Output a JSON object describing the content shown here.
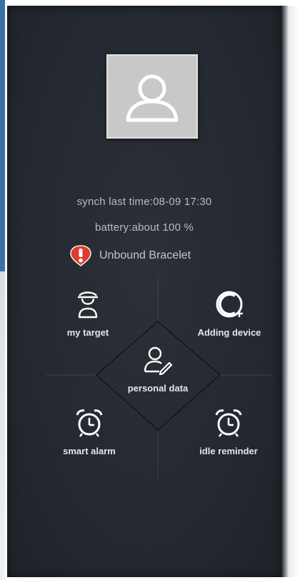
{
  "profile": {
    "avatar_icon": "user-avatar-icon"
  },
  "status": {
    "sync_text": "synch last time:08-09 17:30",
    "battery_text": "battery:about 100 %",
    "bracelet_alert": "Unbound Bracelet",
    "alert_icon": "exclamation-icon",
    "alert_color": "#e03a2f"
  },
  "menu": {
    "my_target": "my target",
    "adding_device": "Adding device",
    "personal_data": "personal data",
    "smart_alarm": "smart alarm",
    "idle_reminder": "idle reminder"
  },
  "colors": {
    "background": "#262a30",
    "accent": "#3b6fa8",
    "text_muted": "#b7bcc3",
    "text_light": "#e4e6e9"
  }
}
